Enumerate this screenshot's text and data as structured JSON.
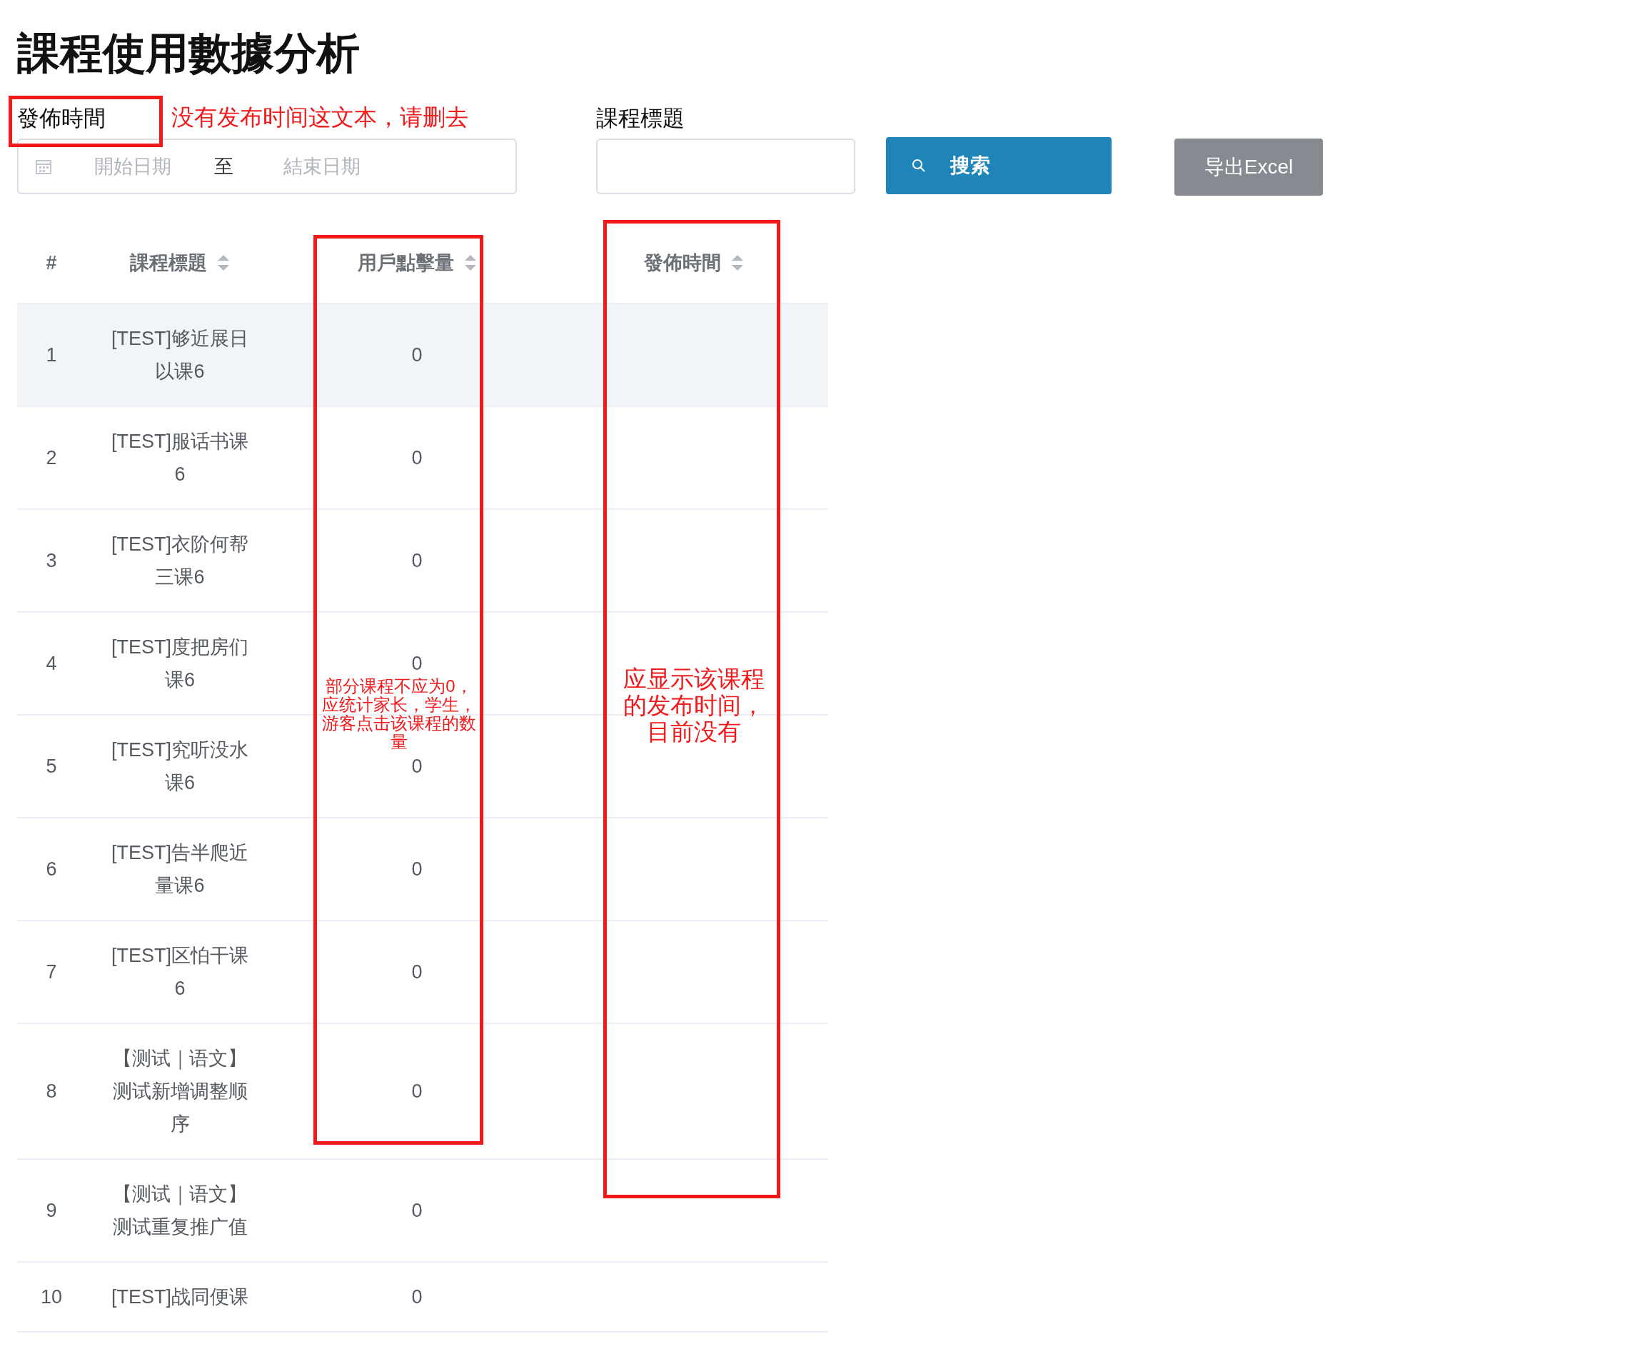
{
  "page": {
    "title": "課程使用數據分析"
  },
  "filters": {
    "date_label": "發佈時間",
    "start_placeholder": "開始日期",
    "separator": "至",
    "end_placeholder": "結束日期",
    "title_label": "課程標題",
    "search_button": "搜索",
    "export_button": "导出Excel"
  },
  "table": {
    "columns": [
      {
        "label": "#",
        "sortable": false
      },
      {
        "label": "課程標題",
        "sortable": true
      },
      {
        "label": "用戶點擊量",
        "sortable": true
      },
      {
        "label": "發佈時間",
        "sortable": true
      }
    ],
    "rows": [
      {
        "number": "1",
        "title": "[TEST]够近展日以课6",
        "clicks": "0",
        "highlighted": true
      },
      {
        "number": "2",
        "title": "[TEST]服话书课6",
        "clicks": "0",
        "highlighted": false
      },
      {
        "number": "3",
        "title": "[TEST]衣阶何帮三课6",
        "clicks": "0",
        "highlighted": false
      },
      {
        "number": "4",
        "title": "[TEST]度把房们课6",
        "clicks": "0",
        "highlighted": false
      },
      {
        "number": "5",
        "title": "[TEST]究听没水课6",
        "clicks": "0",
        "highlighted": false
      },
      {
        "number": "6",
        "title": "[TEST]告半爬近量课6",
        "clicks": "0",
        "highlighted": false
      },
      {
        "number": "7",
        "title": "[TEST]区怕干课6",
        "clicks": "0",
        "highlighted": false
      },
      {
        "number": "8",
        "title": "【测试｜语文】测试新增调整顺序",
        "clicks": "0",
        "highlighted": false
      },
      {
        "number": "9",
        "title": "【测试｜语文】测试重复推广值",
        "clicks": "0",
        "highlighted": false
      },
      {
        "number": "10",
        "title": "[TEST]战同便课",
        "clicks": "0",
        "highlighted": false
      }
    ]
  },
  "annotations": [
    {
      "note": "没有发布时间这文本，请删去"
    },
    {
      "note": "部分课程不应为0，应统计家长，学生，游客点击该课程的数量"
    },
    {
      "note": "应显示该课程的发布时间，目前没有"
    }
  ]
}
